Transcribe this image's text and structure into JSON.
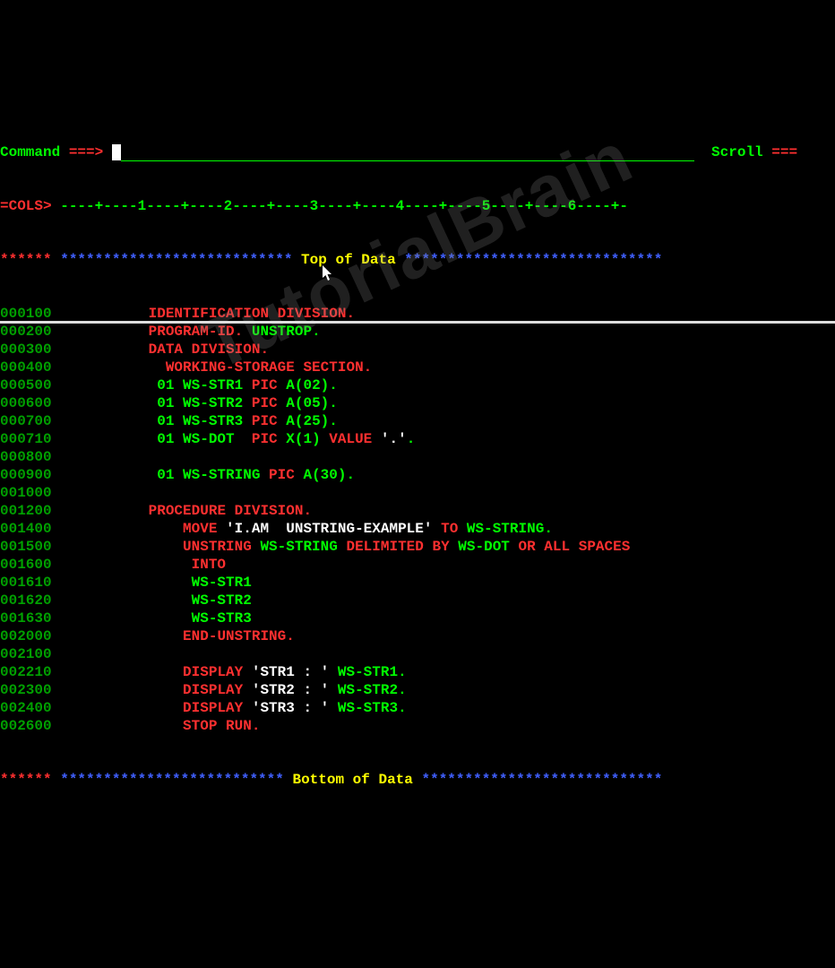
{
  "header": {
    "command_label": "Command",
    "command_arrow": "===>",
    "scroll_label": "Scroll",
    "scroll_arrow": "==="
  },
  "cols": {
    "label": "=COLS>",
    "ruler": " ----+----1----+----2----+----3----+----4----+----5----+----6----+-"
  },
  "top_marker": {
    "stars_left": "******",
    "stars_mid": " ***************************",
    "label": " Top of Data ",
    "stars_right": "******************************"
  },
  "bottom_marker": {
    "stars_left": "******",
    "stars_mid": " **************************",
    "label": " Bottom of Data ",
    "stars_right": "****************************"
  },
  "watermark": "TutorialBrain",
  "lines": [
    {
      "seq": "000100",
      "pad": "           ",
      "t": [
        {
          "c": "red",
          "v": "IDENTIFICATION DIVISION."
        }
      ]
    },
    {
      "seq": "000200",
      "pad": "           ",
      "t": [
        {
          "c": "red",
          "v": "PROGRAM-ID."
        },
        {
          "c": "green",
          "v": " UNSTROP."
        }
      ]
    },
    {
      "seq": "000300",
      "pad": "           ",
      "t": [
        {
          "c": "red",
          "v": "DATA DIVISION."
        }
      ]
    },
    {
      "seq": "000400",
      "pad": "             ",
      "t": [
        {
          "c": "red",
          "v": "WORKING-STORAGE SECTION."
        }
      ]
    },
    {
      "seq": "000500",
      "pad": "            ",
      "t": [
        {
          "c": "green",
          "v": "01 WS-STR1 "
        },
        {
          "c": "red",
          "v": "PIC"
        },
        {
          "c": "green",
          "v": " A(02)."
        }
      ]
    },
    {
      "seq": "000600",
      "pad": "            ",
      "t": [
        {
          "c": "green",
          "v": "01 WS-STR2 "
        },
        {
          "c": "red",
          "v": "PIC"
        },
        {
          "c": "green",
          "v": " A(05)."
        }
      ]
    },
    {
      "seq": "000700",
      "pad": "            ",
      "t": [
        {
          "c": "green",
          "v": "01 WS-STR3 "
        },
        {
          "c": "red",
          "v": "PIC"
        },
        {
          "c": "green",
          "v": " A(25)."
        }
      ]
    },
    {
      "seq": "000710",
      "pad": "            ",
      "t": [
        {
          "c": "green",
          "v": "01 WS-DOT  "
        },
        {
          "c": "red",
          "v": "PIC"
        },
        {
          "c": "green",
          "v": " X(1) "
        },
        {
          "c": "red",
          "v": "VALUE"
        },
        {
          "c": "white",
          "v": " '.'"
        },
        {
          "c": "green",
          "v": "."
        }
      ]
    },
    {
      "seq": "000800",
      "pad": "",
      "t": []
    },
    {
      "seq": "000900",
      "pad": "            ",
      "t": [
        {
          "c": "green",
          "v": "01 WS-STRING "
        },
        {
          "c": "red",
          "v": "PIC"
        },
        {
          "c": "green",
          "v": " A(30)."
        }
      ]
    },
    {
      "seq": "001000",
      "pad": "",
      "t": []
    },
    {
      "seq": "001200",
      "pad": "           ",
      "t": [
        {
          "c": "red",
          "v": "PROCEDURE DIVISION."
        }
      ]
    },
    {
      "seq": "001400",
      "pad": "               ",
      "t": [
        {
          "c": "red",
          "v": "MOVE "
        },
        {
          "c": "white",
          "v": "'I.AM  UNSTRING-EXAMPLE' "
        },
        {
          "c": "red",
          "v": "TO"
        },
        {
          "c": "green",
          "v": " WS-STRING."
        }
      ]
    },
    {
      "seq": "001500",
      "pad": "               ",
      "t": [
        {
          "c": "red",
          "v": "UNSTRING"
        },
        {
          "c": "green",
          "v": " WS-STRING "
        },
        {
          "c": "red",
          "v": "DELIMITED BY"
        },
        {
          "c": "green",
          "v": " WS-DOT "
        },
        {
          "c": "red",
          "v": "OR ALL SPACES"
        }
      ]
    },
    {
      "seq": "001600",
      "pad": "                ",
      "t": [
        {
          "c": "red",
          "v": "INTO"
        }
      ]
    },
    {
      "seq": "001610",
      "pad": "                ",
      "t": [
        {
          "c": "green",
          "v": "WS-STR1"
        }
      ]
    },
    {
      "seq": "001620",
      "pad": "                ",
      "t": [
        {
          "c": "green",
          "v": "WS-STR2"
        }
      ]
    },
    {
      "seq": "001630",
      "pad": "                ",
      "t": [
        {
          "c": "green",
          "v": "WS-STR3"
        }
      ]
    },
    {
      "seq": "002000",
      "pad": "               ",
      "t": [
        {
          "c": "red",
          "v": "END-UNSTRING."
        }
      ]
    },
    {
      "seq": "002100",
      "pad": "",
      "t": []
    },
    {
      "seq": "002210",
      "pad": "               ",
      "t": [
        {
          "c": "red",
          "v": "DISPLAY "
        },
        {
          "c": "white",
          "v": "'STR1 : '"
        },
        {
          "c": "green",
          "v": " WS-STR1."
        }
      ]
    },
    {
      "seq": "002300",
      "pad": "               ",
      "t": [
        {
          "c": "red",
          "v": "DISPLAY "
        },
        {
          "c": "white",
          "v": "'STR2 : '"
        },
        {
          "c": "green",
          "v": " WS-STR2."
        }
      ]
    },
    {
      "seq": "002400",
      "pad": "               ",
      "t": [
        {
          "c": "red",
          "v": "DISPLAY "
        },
        {
          "c": "white",
          "v": "'STR3 : '"
        },
        {
          "c": "green",
          "v": " WS-STR3."
        }
      ]
    },
    {
      "seq": "002600",
      "pad": "               ",
      "t": [
        {
          "c": "red",
          "v": "STOP RUN."
        }
      ]
    }
  ]
}
